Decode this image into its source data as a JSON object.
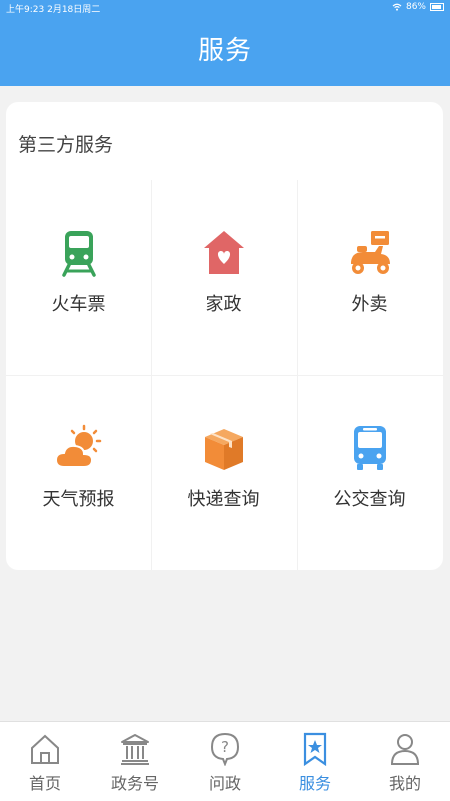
{
  "status": {
    "time": "上午9:23",
    "date": "2月18日周二",
    "battery": "86%",
    "battery_level": 0.86
  },
  "header": {
    "title": "服务"
  },
  "section": {
    "title": "第三方服务",
    "items": [
      {
        "label": "火车票",
        "icon": "train-icon",
        "color": "#3aa35a"
      },
      {
        "label": "家政",
        "icon": "home-heart-icon",
        "color": "#e06666"
      },
      {
        "label": "外卖",
        "icon": "delivery-scooter-icon",
        "color": "#f28c38"
      },
      {
        "label": "天气预报",
        "icon": "weather-sun-cloud-icon",
        "color": "#f28c38"
      },
      {
        "label": "快递查询",
        "icon": "parcel-box-icon",
        "color": "#f28c38"
      },
      {
        "label": "公交查询",
        "icon": "bus-icon",
        "color": "#4aa3f0"
      }
    ]
  },
  "tabbar": {
    "active_color": "#3b8fe0",
    "items": [
      {
        "label": "首页",
        "icon": "home-icon"
      },
      {
        "label": "政务号",
        "icon": "government-building-icon"
      },
      {
        "label": "问政",
        "icon": "question-bubble-icon"
      },
      {
        "label": "服务",
        "icon": "bookmark-star-icon",
        "active": true
      },
      {
        "label": "我的",
        "icon": "user-icon"
      }
    ]
  }
}
